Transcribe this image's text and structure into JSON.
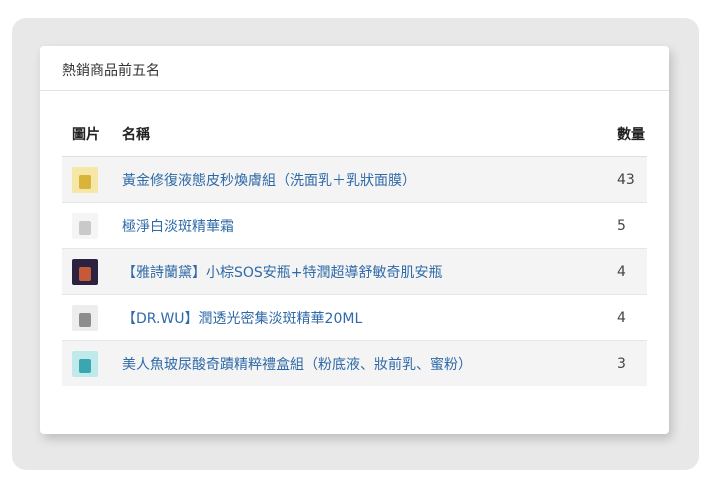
{
  "panel": {
    "title": "熱銷商品前五名"
  },
  "table": {
    "headers": {
      "image": "圖片",
      "name": "名稱",
      "quantity": "數量"
    },
    "rows": [
      {
        "name": "黃金修復液態皮秒煥膚組（洗面乳＋乳狀面膜）",
        "quantity": "43",
        "thumb_icon": "gold-skincare-product-icon",
        "thumb_colors": [
          "#f6e7a6",
          "#d9b43a"
        ]
      },
      {
        "name": "極淨白淡斑精華霜",
        "quantity": "5",
        "thumb_icon": "white-cream-jar-icon",
        "thumb_colors": [
          "#f5f5f5",
          "#c9c9c9"
        ]
      },
      {
        "name": "【雅詩蘭黛】小棕SOS安瓶+特潤超導舒敏奇肌安瓶",
        "quantity": "4",
        "thumb_icon": "model-portrait-icon",
        "thumb_colors": [
          "#2a2240",
          "#c45a3a"
        ]
      },
      {
        "name": "【DR.WU】潤透光密集淡斑精華20ML",
        "quantity": "4",
        "thumb_icon": "serum-bottle-icon",
        "thumb_colors": [
          "#ededed",
          "#8d8d8d"
        ]
      },
      {
        "name": "美人魚玻尿酸奇蹟精粹禮盒組（粉底液、妝前乳、蜜粉）",
        "quantity": "3",
        "thumb_icon": "teal-gift-box-icon",
        "thumb_colors": [
          "#bfe9ea",
          "#3aa7b0"
        ]
      }
    ]
  },
  "colors": {
    "link": "#2f6aa8",
    "stripe": "#f4f4f4",
    "outer_bg": "#e8e8e8"
  }
}
